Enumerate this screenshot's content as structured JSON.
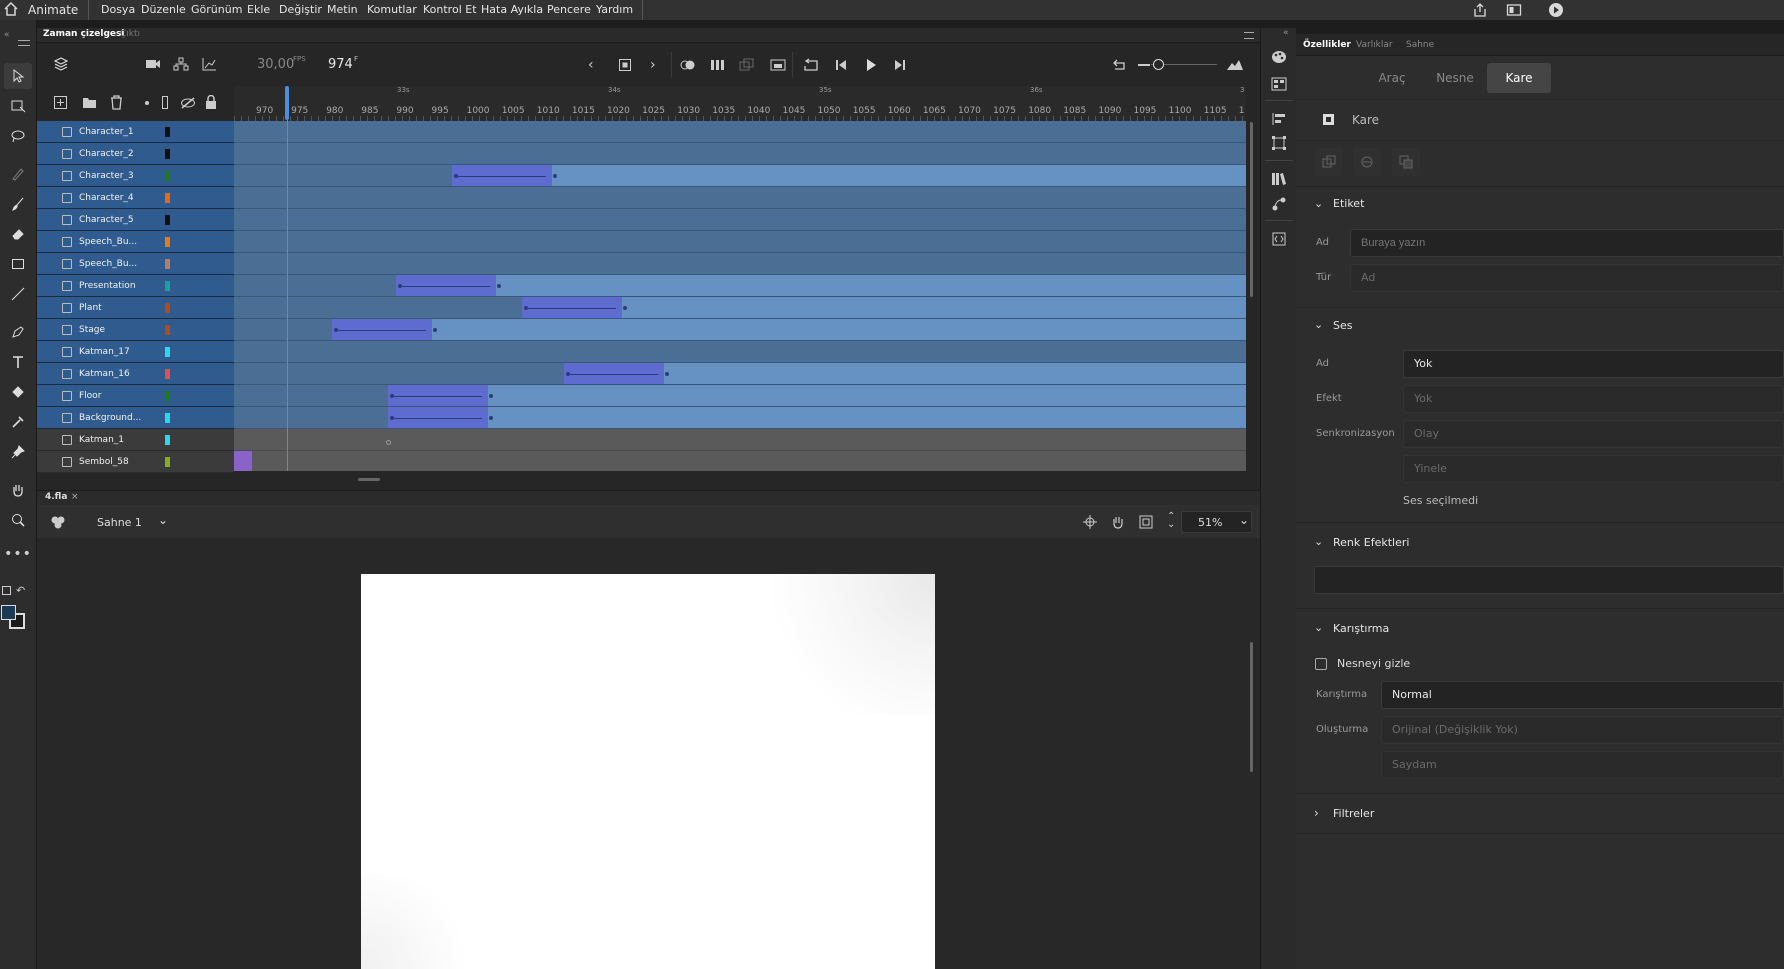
{
  "menubar": {
    "app_name": "Animate",
    "items": [
      "Dosya",
      "Düzenle",
      "Görünüm",
      "Ekle",
      "Değiştir",
      "Metin",
      "Komutlar",
      "Kontrol Et",
      "Hata Ayıkla",
      "Pencere",
      "Yardım"
    ]
  },
  "timeline": {
    "tab_timeline": "Zaman çizelgesi",
    "tab_output": "Çıktı",
    "fps_value": "30,00",
    "fps_unit": "FPS",
    "current_frame": "974",
    "frame_unit": "F",
    "ruler_seconds": [
      "33s",
      "34s",
      "35s",
      "36s",
      "3"
    ],
    "ruler_frames": [
      "970",
      "975",
      "980",
      "985",
      "990",
      "995",
      "1000",
      "1005",
      "1010",
      "1015",
      "1020",
      "1025",
      "1030",
      "1035",
      "1040",
      "1045",
      "1050",
      "1055",
      "1060",
      "1065",
      "1070",
      "1075",
      "1080",
      "1085",
      "1090",
      "1095",
      "1100",
      "1105",
      "1"
    ],
    "layers": [
      {
        "name": "Character_1",
        "color": "#111111"
      },
      {
        "name": "Character_2",
        "color": "#111111"
      },
      {
        "name": "Character_3",
        "color": "#1e7a1e"
      },
      {
        "name": "Character_4",
        "color": "#e46a1a"
      },
      {
        "name": "Character_5",
        "color": "#111111"
      },
      {
        "name": "Speech_Bu...",
        "color": "#e47b1a"
      },
      {
        "name": "Speech_Bu...",
        "color": "#b08060"
      },
      {
        "name": "Presentation",
        "color": "#1aa0a0"
      },
      {
        "name": "Plant",
        "color": "#b04a20"
      },
      {
        "name": "Stage",
        "color": "#b04a20"
      },
      {
        "name": "Katman_17",
        "color": "#28d8f0"
      },
      {
        "name": "Katman_16",
        "color": "#e05050"
      },
      {
        "name": "Floor",
        "color": "#1e7a1e"
      },
      {
        "name": "Background...",
        "color": "#28d8f0"
      },
      {
        "name": "Katman_1",
        "color": "#28d8f0"
      },
      {
        "name": "Sembol_58",
        "color": "#80b020"
      }
    ]
  },
  "stage": {
    "doc_tab": "4.fla",
    "scene_name": "Sahne 1",
    "zoom": "51%"
  },
  "properties": {
    "tabs": [
      "Özellikler",
      "Varlıklar",
      "Sahne"
    ],
    "mode_buttons": [
      "Araç",
      "Nesne",
      "Kare"
    ],
    "selected_mode": "Kare",
    "object_type": "Kare",
    "label_section": "Etiket",
    "label_name_label": "Ad",
    "label_name_placeholder": "Buraya yazın",
    "label_type_label": "Tür",
    "label_type_value": "Ad",
    "sound_section": "Ses",
    "sound_name_label": "Ad",
    "sound_name_value": "Yok",
    "sound_effect_label": "Efekt",
    "sound_effect_value": "Yok",
    "sound_sync_label": "Senkronizasyon",
    "sound_sync_value": "Olay",
    "sound_repeat_value": "Yinele",
    "sound_status": "Ses seçilmedi",
    "color_effects_section": "Renk Efektleri",
    "blending_section": "Karıştırma",
    "hide_object_label": "Nesneyi gizle",
    "blend_label": "Karıştırma",
    "blend_value": "Normal",
    "render_label": "Oluşturma",
    "render_value": "Orijinal (Değişiklik Yok)",
    "transparent_value": "Saydam",
    "filters_section": "Filtreler"
  }
}
